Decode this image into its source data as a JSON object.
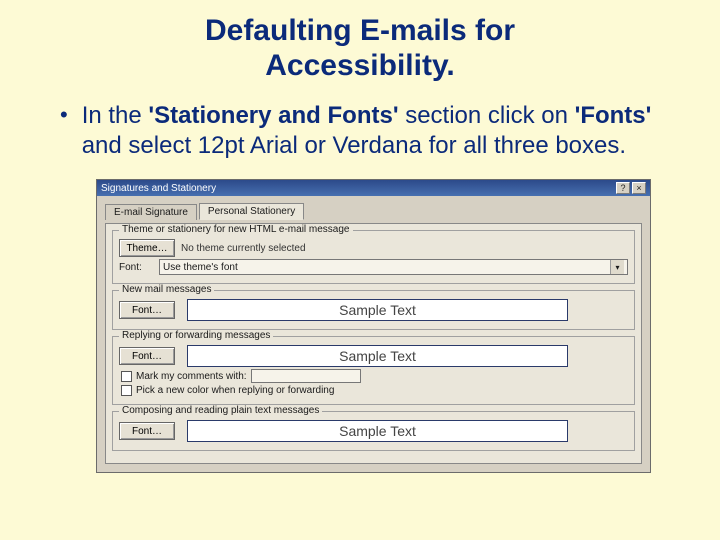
{
  "title_line1": "Defaulting E-mails for",
  "title_line2": "Accessibility.",
  "bullet_html": {
    "part1": "In the ",
    "bold1": "'Stationery and Fonts'",
    "part2": " section click on ",
    "bold2": "'Fonts'",
    "part3": " and select 12pt Arial or Verdana for all three boxes."
  },
  "dialog": {
    "title": "Signatures and Stationery",
    "help": "?",
    "close": "×",
    "tab_inactive": "E-mail Signature",
    "tab_active": "Personal Stationery",
    "group1": {
      "legend": "Theme or stationery for new HTML e-mail message",
      "theme_btn": "Theme…",
      "theme_note": "No theme currently selected",
      "font_label": "Font:",
      "font_select": "Use theme's font"
    },
    "group2": {
      "legend": "New mail messages",
      "font_btn": "Font…",
      "sample": "Sample Text"
    },
    "group3": {
      "legend": "Replying or forwarding messages",
      "font_btn": "Font…",
      "sample": "Sample Text",
      "chk1": "Mark my comments with:",
      "chk2": "Pick a new color when replying or forwarding"
    },
    "group4": {
      "legend": "Composing and reading plain text messages",
      "font_btn": "Font…",
      "sample": "Sample Text"
    }
  }
}
